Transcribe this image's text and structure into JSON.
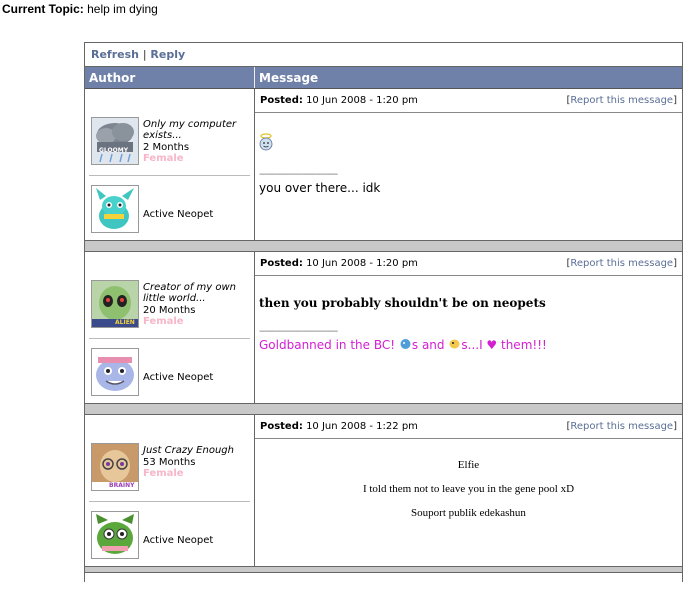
{
  "topic": {
    "label": "Current Topic:",
    "value": "help im dying"
  },
  "toolbar": {
    "refresh": "Refresh",
    "separator": "|",
    "reply": "Reply"
  },
  "header": {
    "author": "Author",
    "message": "Message"
  },
  "posts": [
    {
      "user_title": "Only my computer exists...",
      "months": "2 Months",
      "gender": "Female",
      "status": "Active Neopet",
      "posted_label": "Posted:",
      "posted_time": "10 Jun 2008 - 1:20 pm",
      "report_open": "[",
      "report_link": "Report this message",
      "report_close": "]",
      "message": "",
      "sig_dashes": "------------------------------",
      "signature": "you over there... idk",
      "avatar_text": "GLOOMY"
    },
    {
      "user_title": "Creator of my own little world...",
      "months": "20 Months",
      "gender": "Female",
      "status": "Active Neopet",
      "posted_label": "Posted:",
      "posted_time": "10 Jun 2008 - 1:20 pm",
      "report_open": "[",
      "report_link": "Report this message",
      "report_close": "]",
      "message": "then you probably shouldn't be on neopets",
      "sig_dashes": "------------------------------",
      "sig_part1": "Goldbanned in the BC!",
      "sig_part2": "s and",
      "sig_part3": "s...I ♥ them!!!",
      "avatar_text": "ALIEN"
    },
    {
      "user_title": "Just Crazy Enough",
      "months": "53 Months",
      "gender": "Female",
      "status": "Active Neopet",
      "posted_label": "Posted:",
      "posted_time": "10 Jun 2008 - 1:22 pm",
      "report_open": "[",
      "report_link": "Report this message",
      "report_close": "]",
      "line1": "Elfie",
      "line2": "I told them not to leave you in the gene pool xD",
      "line3": "Souport publik edekashun",
      "avatar_text": "BRAINY"
    }
  ],
  "colors": {
    "header_bg": "#6f80a9",
    "link": "#5a6e96",
    "spacer": "#c8c8c8",
    "gender": "#f7b6c8",
    "sig_pink": "#d21fd2"
  }
}
